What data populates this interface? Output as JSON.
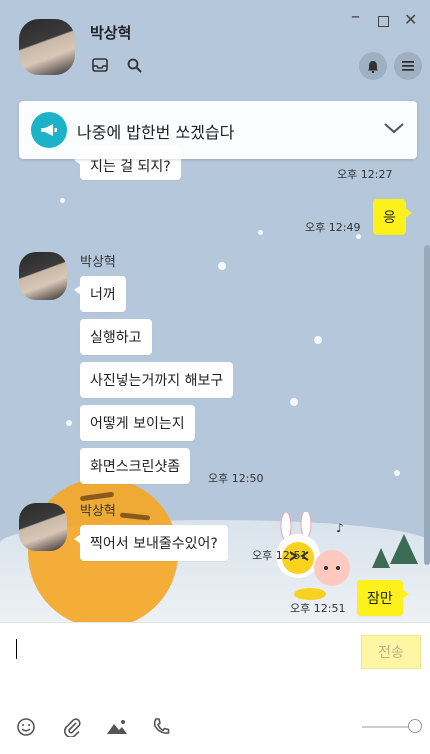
{
  "header": {
    "contact_name": "박상혁",
    "icons": [
      "inbox-icon",
      "search-icon",
      "bell-icon",
      "menu-icon"
    ],
    "window_controls": [
      "minimize",
      "maximize",
      "close"
    ]
  },
  "notice": {
    "text": "나중에 밥한번 쏘겠습다",
    "icon": "megaphone-icon"
  },
  "messages": {
    "m0": {
      "text": "지는 걸 되지?",
      "time": "오후 12:27"
    },
    "m1": {
      "text": "응",
      "time": "오후 12:49"
    },
    "sender1": "박상혁",
    "m2": {
      "text": "너꺼"
    },
    "m3": {
      "text": "실행하고"
    },
    "m4": {
      "text": "사진넣는거까지 해보구"
    },
    "m5": {
      "text": "어떻게 보이는지"
    },
    "m6": {
      "text": "화면스크린샷좀",
      "time": "오후 12:50"
    },
    "sender2": "박상혁",
    "m7": {
      "text": "찍어서 보내줄수있어?",
      "time": "오후 12:51"
    },
    "m8": {
      "text": "잠만",
      "time": "오후 12:51"
    }
  },
  "composer": {
    "send_label": "전송",
    "tools": [
      "emoticon-icon",
      "attach-icon",
      "image-icon",
      "call-icon"
    ]
  },
  "colors": {
    "chat_bg": "#b5c7da",
    "my_bubble": "#fef01b",
    "notice_icon": "#1cb3c8"
  }
}
